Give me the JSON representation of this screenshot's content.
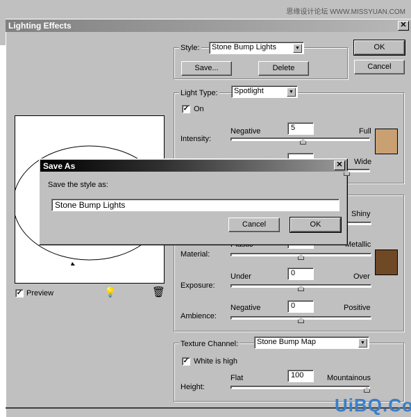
{
  "watermark_top": "思缘设计论坛 WWW.MISSYUAN.COM",
  "watermark_bottom": "UiBQ.CoM",
  "window": {
    "title": "Lighting Effects",
    "close": "✕"
  },
  "style": {
    "label": "Style:",
    "value": "Stone Bump Lights",
    "save": "Save...",
    "delete": "Delete"
  },
  "ok": "OK",
  "cancel": "Cancel",
  "light": {
    "label": "Light Type:",
    "value": "Spotlight",
    "on_label": "On",
    "on_checked": true,
    "intensity": {
      "label": "Intensity:",
      "min": "Negative",
      "max": "Full",
      "value": "5",
      "level": 0.52
    },
    "focus": {
      "max": "Wide",
      "level": 0.85
    },
    "color": "#c9a072"
  },
  "properties": {
    "gloss": {
      "max": "Shiny"
    },
    "material": {
      "label": "Material:",
      "min": "Plastic",
      "max": "Metallic",
      "level": 0.5
    },
    "exposure": {
      "label": "Exposure:",
      "min": "Under",
      "max": "Over",
      "value": "0",
      "level": 0.5
    },
    "ambience": {
      "label": "Ambience:",
      "min": "Negative",
      "max": "Positive",
      "value": "0",
      "level": 0.5
    },
    "color": "#6f4826"
  },
  "texture": {
    "label": "Texture Channel:",
    "value": "Stone Bump Map",
    "white_high_label": "White is high",
    "white_high_checked": true,
    "height": {
      "label": "Height:",
      "min": "Flat",
      "max": "Mountainous",
      "value": "100",
      "level": 1.0
    }
  },
  "preview": {
    "label": "Preview",
    "checked": true
  },
  "save_as": {
    "title": "Save As",
    "prompt": "Save the style as:",
    "value": "Stone Bump Lights",
    "cancel": "Cancel",
    "ok": "OK",
    "close": "✕"
  }
}
